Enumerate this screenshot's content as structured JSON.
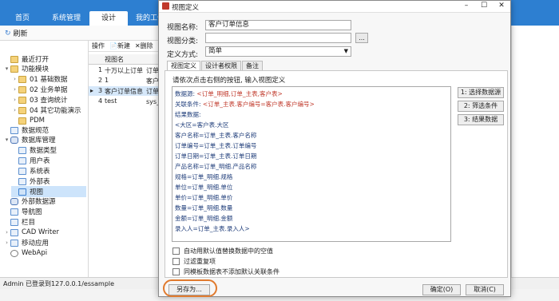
{
  "app": {
    "tabs": [
      "首页",
      "系统管理",
      "设计",
      "我的工作"
    ],
    "active_tab": "设计",
    "refresh_label": "刷新",
    "accent": "#2d7fd1"
  },
  "sidebar": {
    "items": [
      {
        "label": "最近打开",
        "icon": "folder-icon"
      },
      {
        "label": "功能模块",
        "icon": "folder-icon",
        "arrow": "▾"
      },
      {
        "label": "01 基础数据",
        "icon": "folder-icon",
        "arrow": "›"
      },
      {
        "label": "02 业务单据",
        "icon": "folder-icon",
        "arrow": "›"
      },
      {
        "label": "03 查询统计",
        "icon": "folder-icon",
        "arrow": "›"
      },
      {
        "label": "04 其它功能演示",
        "icon": "folder-icon",
        "arrow": "›"
      },
      {
        "label": "PDM",
        "icon": "folder-icon"
      },
      {
        "label": "数据规范",
        "icon": "table-icon"
      },
      {
        "label": "数据库管理",
        "icon": "database-icon",
        "arrow": "▾"
      },
      {
        "label": "数据类型",
        "icon": "table-icon"
      },
      {
        "label": "用户表",
        "icon": "table-icon"
      },
      {
        "label": "系统表",
        "icon": "table-icon"
      },
      {
        "label": "外部表",
        "icon": "table-icon"
      },
      {
        "label": "视图",
        "icon": "table-icon"
      },
      {
        "label": "外部数据源",
        "icon": "database-icon"
      },
      {
        "label": "导航图",
        "icon": "table-icon"
      },
      {
        "label": "栏目",
        "icon": "table-icon"
      },
      {
        "label": "CAD Writer",
        "icon": "table-icon",
        "arrow": "›"
      },
      {
        "label": "移动应用",
        "icon": "table-icon",
        "arrow": "›"
      },
      {
        "label": "WebApi",
        "icon": "globe-icon"
      }
    ]
  },
  "middle": {
    "toolbar": {
      "ops": "操作",
      "new": "新建",
      "delete": "删除"
    },
    "column": "视图名",
    "rows": [
      {
        "num": "1",
        "name": "十万以上订单",
        "extra": "订单_"
      },
      {
        "num": "2",
        "name": "1",
        "extra": "客户表"
      },
      {
        "num": "3",
        "name": "客户订单信息",
        "extra": "订单_"
      },
      {
        "num": "4",
        "name": "test",
        "extra": "sys_用"
      }
    ],
    "selected_row": 2
  },
  "statusbar": {
    "text": "Admin 已登录到127.0.0.1/essample"
  },
  "dialog": {
    "title": "视图定义",
    "name_label": "视图名称:",
    "name_value": "客户订单信息",
    "category_label": "视图分类:",
    "category_value": "",
    "browse_label": "...",
    "method_label": "定义方式:",
    "method_value": "简单",
    "tabs": [
      "视图定义",
      "设计者权限",
      "备注"
    ],
    "instruction": "请依次点击右侧的按钮, 输入视图定义",
    "definition": [
      {
        "key": "数据源:",
        "value": "<订单_明细,订单_主表,客户表>"
      },
      {
        "key": "关联条件:",
        "value": "<订单_主表.客户编号=客户表.客户编号>"
      },
      {
        "key": "结果数据:",
        "value": ""
      },
      {
        "key": "<大区=客户表.大区",
        "value": ""
      },
      {
        "key": "客户名称=订单_主表.客户名称",
        "value": ""
      },
      {
        "key": "订单编号=订单_主表.订单编号",
        "value": ""
      },
      {
        "key": "订单日期=订单_主表.订单日期",
        "value": ""
      },
      {
        "key": "产品名称=订单_明细.产品名称",
        "value": ""
      },
      {
        "key": "规格=订单_明细.规格",
        "value": ""
      },
      {
        "key": "单位=订单_明细.单位",
        "value": ""
      },
      {
        "key": "单价=订单_明细.单价",
        "value": ""
      },
      {
        "key": "数量=订单_明细.数量",
        "value": ""
      },
      {
        "key": "金额=订单_明细.金额",
        "value": ""
      },
      {
        "key": "录入人=订单_主表.录入人>",
        "value": ""
      }
    ],
    "side_buttons": [
      "1: 选择数据源",
      "2: 筛选条件",
      "3: 结果数据"
    ],
    "checkboxes": [
      "自动用默认值替换数据中的空值",
      "过滤重复项",
      "同模板数据表不添加默认关联条件"
    ],
    "save_as": "另存为...",
    "ok": "确定(O)",
    "cancel": "取消(C)",
    "highlight_color": "#e07a2e"
  }
}
